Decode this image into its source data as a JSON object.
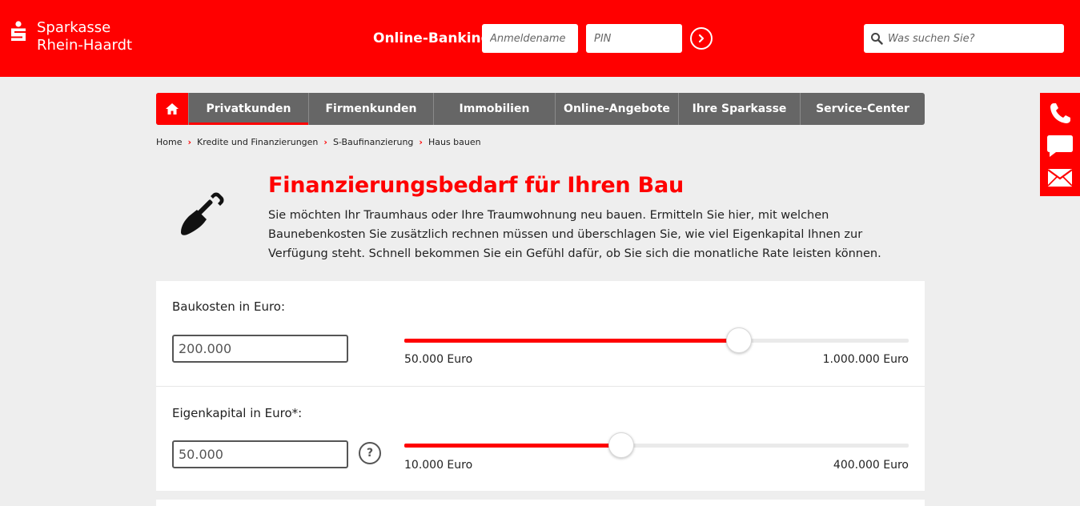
{
  "colors": {
    "brand_red": "#ff0000",
    "nav_gray": "#666666",
    "page_bg": "#eeeeee"
  },
  "header": {
    "logo_icon": "sparkasse-s-logo",
    "logo_line1": "Sparkasse",
    "logo_line2": "Rhein-Haardt",
    "online_banking_label": "Online-Banking",
    "username_placeholder": "Anmeldename",
    "pin_placeholder": "PIN",
    "login_icon": "chevron-right-icon",
    "search_placeholder": "Was suchen Sie?",
    "search_icon": "search-icon"
  },
  "nav": {
    "home_icon": "home-icon",
    "items": [
      {
        "label": "Privatkunden",
        "active": true
      },
      {
        "label": "Firmenkunden",
        "active": false
      },
      {
        "label": "Immobilien",
        "active": false
      },
      {
        "label": "Online-Angebote",
        "active": false
      },
      {
        "label": "Ihre Sparkasse",
        "active": false
      },
      {
        "label": "Service-Center",
        "active": false
      }
    ]
  },
  "breadcrumb": {
    "items": [
      "Home",
      "Kredite und Finanzierungen",
      "S-Baufinanzierung",
      "Haus bauen"
    ]
  },
  "side_contact": {
    "icons": [
      "phone-icon",
      "chat-icon",
      "mail-icon"
    ]
  },
  "intro": {
    "icon": "shovel-icon",
    "title": "Finanzierungsbedarf für Ihren Bau",
    "text": "Sie möchten Ihr Traumhaus oder Ihre Traumwohnung neu bauen. Ermitteln Sie hier, mit welchen Baunebenkosten Sie zusätzlich rechnen müssen und überschlagen Sie, wie viel Eigenkapital Ihnen zur Verfügung steht. Schnell bekommen Sie ein Gefühl dafür, ob Sie sich die monatliche Rate leisten können."
  },
  "calculator": {
    "baukosten": {
      "label": "Baukosten in Euro:",
      "value": "200.000",
      "min_label": "50.000 Euro",
      "max_label": "1.000.000 Euro",
      "min": 50000,
      "max": 1000000,
      "current": 200000
    },
    "eigenkapital": {
      "label": "Eigenkapital in Euro*:",
      "value": "50.000",
      "help_label": "?",
      "min_label": "10.000 Euro",
      "max_label": "400.000 Euro",
      "min": 10000,
      "max": 400000,
      "current": 50000
    }
  }
}
